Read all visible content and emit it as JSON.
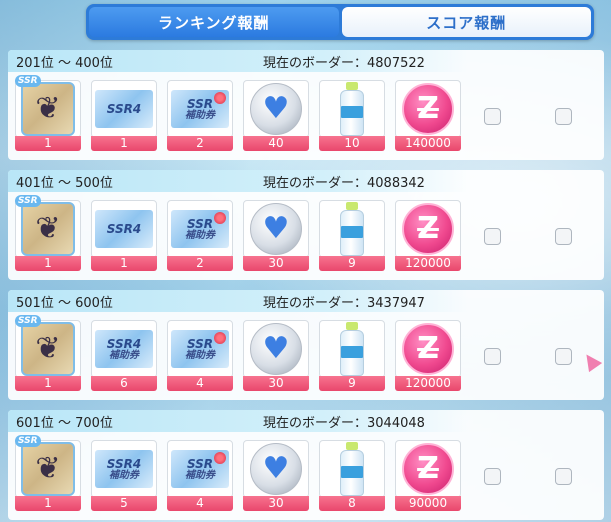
{
  "tabs": [
    {
      "label": "ランキング報酬",
      "active": true
    },
    {
      "label": "スコア報酬",
      "active": false
    }
  ],
  "icon_names": {
    "ssr_card": "butterfly-ssr-card-icon",
    "ticket_4star": "ssr-4star-ticket-icon",
    "ticket_support": "ssr-support-ticket-icon",
    "heart": "blue-heart-medal-icon",
    "bottle": "water-bottle-icon",
    "coin": "pink-z-coin-icon"
  },
  "ticket_text": {
    "ssr": "SSR",
    "star4": "4",
    "support": "補助券"
  },
  "ssr_tag": "SSR",
  "panels": [
    {
      "range": "201位 〜 400位",
      "border": "現在のボーダー：4807522",
      "counts": [
        "1",
        "1",
        "2",
        "40",
        "10",
        "140000"
      ],
      "second_ticket": "star4"
    },
    {
      "range": "401位 〜 500位",
      "border": "現在のボーダー：4088342",
      "counts": [
        "1",
        "1",
        "2",
        "30",
        "9",
        "120000"
      ],
      "second_ticket": "star4"
    },
    {
      "range": "501位 〜 600位",
      "border": "現在のボーダー：3437947",
      "counts": [
        "1",
        "6",
        "4",
        "30",
        "9",
        "120000"
      ],
      "second_ticket": "support"
    },
    {
      "range": "601位 〜 700位",
      "border": "現在のボーダー：3044048",
      "counts": [
        "1",
        "5",
        "4",
        "30",
        "8",
        "90000"
      ],
      "second_ticket": "support"
    }
  ],
  "colors": {
    "tab_active": "#2b7ae0",
    "count_bar": "#e9476c",
    "coin": "#f0498f",
    "heart": "#3d7fe2"
  }
}
